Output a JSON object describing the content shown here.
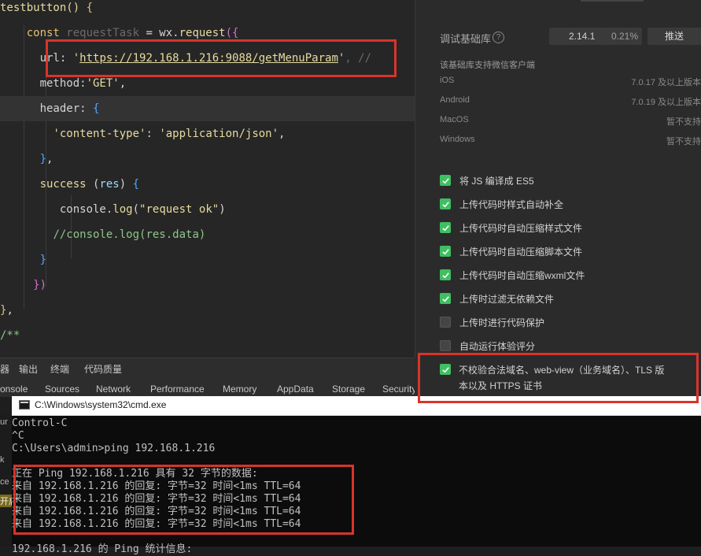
{
  "editor": {
    "lines": [
      [
        [
          "testbutton() ",
          "t-fn"
        ],
        [
          "{",
          "t-br1"
        ]
      ],
      [
        [
          "    const ",
          "t-kw"
        ],
        [
          "requestTask",
          "t-fade"
        ],
        [
          " = wx.",
          "t-plain"
        ],
        [
          "request",
          "t-fn"
        ],
        [
          "({",
          "t-br2"
        ]
      ],
      [
        [
          "      url: ",
          "t-prop"
        ],
        [
          "'",
          "t-str"
        ],
        [
          "https://192.168.1.216:9088/getMenuParam",
          "t-url"
        ],
        [
          "'",
          "t-str"
        ],
        [
          ", //",
          "t-fade"
        ]
      ],
      [
        [
          "      method:",
          "t-prop"
        ],
        [
          "'GET'",
          "t-str"
        ],
        [
          ",",
          "t-plain"
        ]
      ],
      [
        [
          "      header: ",
          "t-prop"
        ],
        [
          "{",
          "t-br3"
        ]
      ],
      [
        [
          "        ",
          "t-plain"
        ],
        [
          "'content-type'",
          "t-str"
        ],
        [
          ": ",
          "t-plain"
        ],
        [
          "'application/json'",
          "t-str"
        ],
        [
          ",",
          "t-plain"
        ]
      ],
      [
        [
          "      ",
          "t-plain"
        ],
        [
          "}",
          "t-br3"
        ],
        [
          ",",
          "t-plain"
        ]
      ],
      [
        [
          "      success ",
          "t-fn"
        ],
        [
          "(",
          "t-plain"
        ],
        [
          "res",
          "t-var"
        ],
        [
          ") ",
          "t-plain"
        ],
        [
          "{",
          "t-br3"
        ]
      ],
      [
        [
          "         console.",
          "t-plain"
        ],
        [
          "log",
          "t-fn"
        ],
        [
          "(",
          "t-plain"
        ],
        [
          "\"request ok\"",
          "t-str"
        ],
        [
          ")",
          "t-plain"
        ]
      ],
      [
        [
          "        ",
          "t-plain"
        ],
        [
          "//console.log(res.data)",
          "t-com"
        ]
      ],
      [
        [
          "      ",
          "t-plain"
        ],
        [
          "}",
          "t-br3"
        ]
      ],
      [
        [
          "     ",
          "t-plain"
        ],
        [
          "})",
          "t-br2"
        ]
      ],
      [
        [
          "}",
          "t-br1"
        ],
        [
          ",",
          "t-plain"
        ]
      ],
      [
        [
          "/**",
          "t-com"
        ]
      ]
    ]
  },
  "panel": {
    "base_lib_label": "调试基础库",
    "help_icon": "question-circle-icon",
    "version": "2.14.1",
    "percent": "0.21%",
    "push_button": "推送",
    "support_title": "该基础库支持微信客户端",
    "platforms": [
      {
        "name": "iOS",
        "value": "7.0.17 及以上版本"
      },
      {
        "name": "Android",
        "value": "7.0.19 及以上版本"
      },
      {
        "name": "MacOS",
        "value": "暂不支持"
      },
      {
        "name": "Windows",
        "value": "暂不支持"
      }
    ],
    "checkboxes": [
      {
        "label": "将 JS 编译成 ES5",
        "checked": true
      },
      {
        "label": "上传代码时样式自动补全",
        "checked": true
      },
      {
        "label": "上传代码时自动压缩样式文件",
        "checked": true
      },
      {
        "label": "上传代码时自动压缩脚本文件",
        "checked": true
      },
      {
        "label": "上传代码时自动压缩wxml文件",
        "checked": true
      },
      {
        "label": "上传时过滤无依赖文件",
        "checked": true
      },
      {
        "label": "上传时进行代码保护",
        "checked": false
      },
      {
        "label": "自动运行体验评分",
        "checked": false
      }
    ],
    "domain_check": {
      "line1": "不校验合法域名、web-view（业务域名）、TLS 版",
      "line2": "本以及 HTTPS 证书",
      "checked": true
    }
  },
  "devtools": {
    "tabs_top": [
      "器",
      "输出",
      "终端",
      "代码质量"
    ],
    "tabs_panels": [
      "onsole",
      "Sources",
      "Network",
      "Performance",
      "Memory",
      "AppData",
      "Storage",
      "Security"
    ]
  },
  "cmd": {
    "title": "C:\\Windows\\system32\\cmd.exe",
    "lines": [
      "Control-C",
      "^C",
      "C:\\Users\\admin>ping 192.168.1.216",
      "",
      "正在 Ping 192.168.1.216 具有 32 字节的数据:",
      "来自 192.168.1.216 的回复: 字节=32 时间<1ms TTL=64",
      "来自 192.168.1.216 的回复: 字节=32 时间<1ms TTL=64",
      "来自 192.168.1.216 的回复: 字节=32 时间<1ms TTL=64",
      "来自 192.168.1.216 的回复: 字节=32 时间<1ms TTL=64",
      "",
      "192.168.1.216 的 Ping 统计信息:"
    ]
  },
  "left_strip": [
    "ur",
    "k",
    "ce",
    "开启"
  ]
}
